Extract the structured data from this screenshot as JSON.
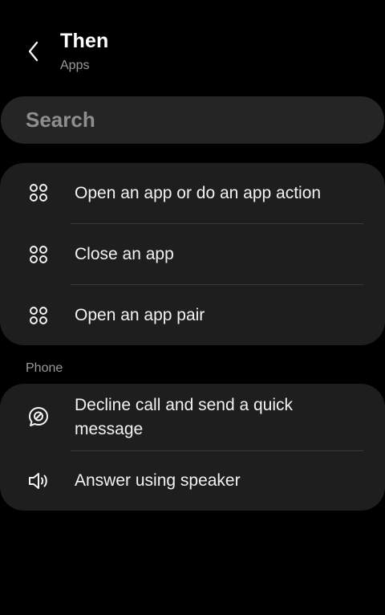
{
  "header": {
    "title": "Then",
    "subtitle": "Apps",
    "back_icon": "chevron-left-icon"
  },
  "search": {
    "placeholder": "Search"
  },
  "apps_group": {
    "items": [
      {
        "label": "Open an app or do an app action",
        "icon": "apps-grid-icon"
      },
      {
        "label": "Close an app",
        "icon": "apps-grid-icon"
      },
      {
        "label": "Open an app pair",
        "icon": "apps-grid-icon"
      }
    ]
  },
  "phone_group": {
    "section_label": "Phone",
    "items": [
      {
        "label": "Decline call and send a quick message",
        "icon": "message-decline-icon"
      },
      {
        "label": "Answer using speaker",
        "icon": "speaker-icon"
      }
    ]
  },
  "colors": {
    "background": "#000000",
    "card": "#1e1e1e",
    "search": "#252525",
    "primary_text": "#f2f2f2",
    "secondary_text": "#9a9a9a",
    "divider": "#3a3a3a"
  }
}
